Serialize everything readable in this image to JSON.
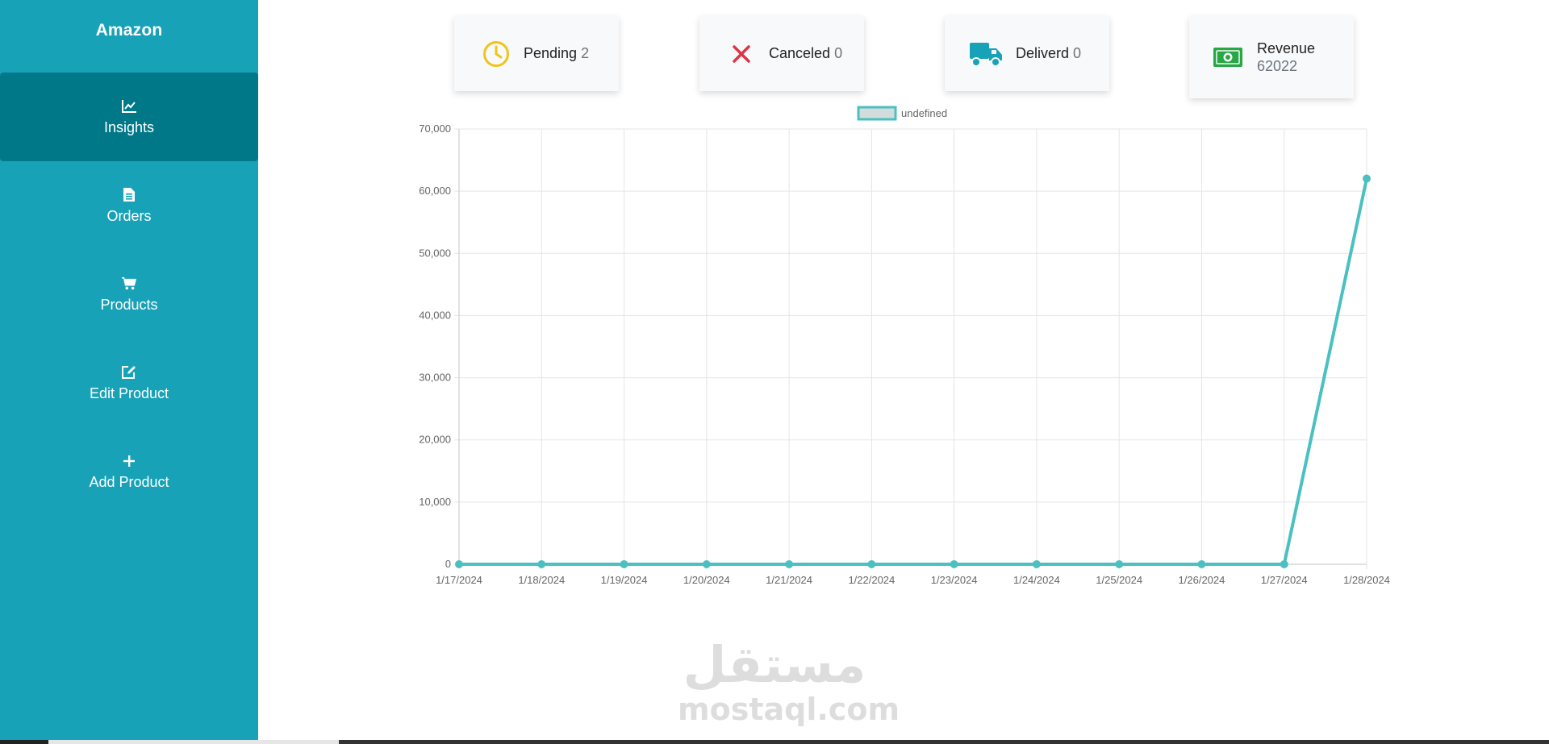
{
  "sidebar": {
    "brand": "Amazon",
    "items": [
      {
        "label": "Insights",
        "icon": "chart-line-icon",
        "active": true
      },
      {
        "label": "Orders",
        "icon": "document-icon",
        "active": false
      },
      {
        "label": "Products",
        "icon": "cart-icon",
        "active": false
      },
      {
        "label": "Edit Product",
        "icon": "edit-icon",
        "active": false
      },
      {
        "label": "Add Product",
        "icon": "plus-icon",
        "active": false
      }
    ]
  },
  "stats": {
    "pending": {
      "label": "Pending",
      "value": "2",
      "icon": "clock-icon",
      "color": "#f0c419"
    },
    "canceled": {
      "label": "Canceled",
      "value": "0",
      "icon": "close-icon",
      "color": "#dc3545"
    },
    "delivered": {
      "label": "Deliverd",
      "value": "0",
      "icon": "truck-icon",
      "color": "#17a2b8"
    },
    "revenue": {
      "label": "Revenue",
      "value": "62022",
      "icon": "money-icon",
      "color": "#28a745"
    }
  },
  "chart_data": {
    "type": "line",
    "x": [
      "1/17/2024",
      "1/18/2024",
      "1/19/2024",
      "1/20/2024",
      "1/21/2024",
      "1/22/2024",
      "1/23/2024",
      "1/24/2024",
      "1/25/2024",
      "1/26/2024",
      "1/27/2024",
      "1/28/2024"
    ],
    "series": [
      {
        "name": "undefined",
        "values": [
          0,
          0,
          0,
          0,
          0,
          0,
          0,
          0,
          0,
          0,
          0,
          62022
        ]
      }
    ],
    "ylim": [
      0,
      70000
    ],
    "yticks": [
      0,
      10000,
      20000,
      30000,
      40000,
      50000,
      60000,
      70000
    ],
    "ytick_labels": [
      "0",
      "10,000",
      "20,000",
      "30,000",
      "40,000",
      "50,000",
      "60,000",
      "70,000"
    ],
    "grid": true,
    "legend": "top",
    "line_color": "#4bc0c0",
    "legend_fill": "#d3dcdc"
  },
  "watermark": {
    "arabic": "مستقل",
    "latin": "mostaql.com"
  }
}
